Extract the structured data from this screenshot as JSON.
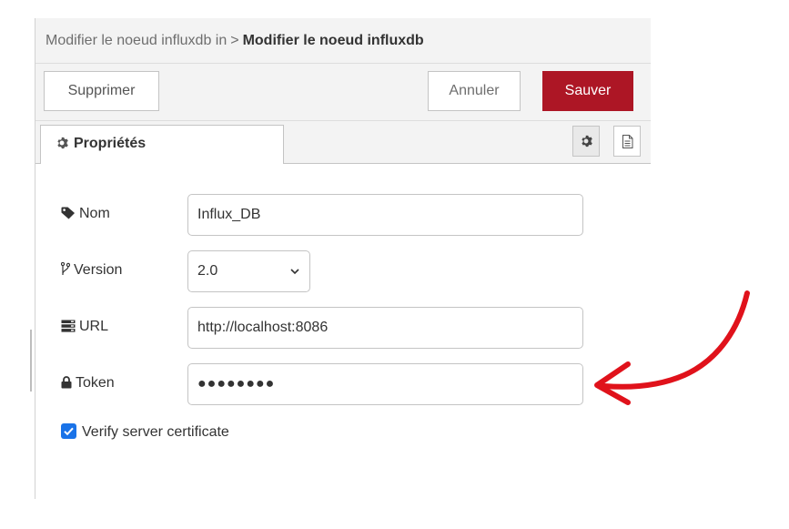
{
  "breadcrumb": {
    "previous": "Modifier le noeud influxdb in",
    "separator": ">",
    "current": "Modifier le noeud influxdb"
  },
  "toolbar": {
    "delete_label": "Supprimer",
    "cancel_label": "Annuler",
    "save_label": "Sauver",
    "save_color": "#ad1625"
  },
  "tabs": {
    "properties_label": "Propriétés",
    "properties_icon": "gear-icon",
    "side_icons": [
      "gear-icon",
      "document-icon"
    ]
  },
  "form": {
    "name": {
      "label": "Nom",
      "icon": "tag-icon",
      "value": "Influx_DB"
    },
    "version": {
      "label": "Version",
      "icon": "branch-icon",
      "selected": "2.0"
    },
    "url": {
      "label": "URL",
      "icon": "server-icon",
      "value": "http://localhost:8086"
    },
    "token": {
      "label": "Token",
      "icon": "lock-icon",
      "masked_value": "●●●●●●●●"
    },
    "verify_cert": {
      "label": "Verify server certificate",
      "checked": true,
      "color": "#1a73e8"
    }
  },
  "annotation": {
    "arrow_color": "#e0121b"
  }
}
